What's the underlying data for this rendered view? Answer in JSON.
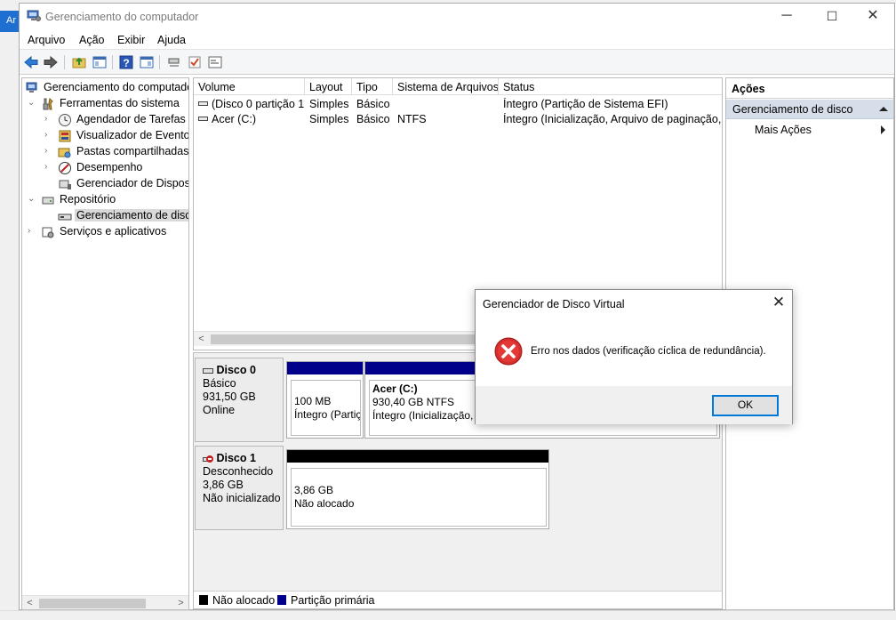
{
  "background": {
    "left_text": "Ar"
  },
  "window": {
    "title": "Gerenciamento do computador",
    "controls": {
      "minimize": "─",
      "maximize": "☐",
      "close": "✕"
    }
  },
  "menu": [
    "Arquivo",
    "Ação",
    "Exibir",
    "Ajuda"
  ],
  "toolbar": [
    "back-arrow-icon",
    "forward-arrow-icon",
    "up-folder-icon",
    "show-hide-tree-icon",
    "help-icon",
    "properties-icon",
    "connect-icon",
    "check-icon",
    "console-icon"
  ],
  "tree": {
    "root": "Gerenciamento do computado",
    "items": [
      {
        "label": "Ferramentas do sistema",
        "expander": "⌄"
      },
      {
        "label": "Agendador de Tarefas",
        "expander": "›"
      },
      {
        "label": "Visualizador de Eventos",
        "expander": "›"
      },
      {
        "label": "Pastas compartilhadas",
        "expander": "›"
      },
      {
        "label": "Desempenho",
        "expander": "›"
      },
      {
        "label": "Gerenciador de Disposit",
        "expander": ""
      },
      {
        "label": "Repositório",
        "expander": "⌄"
      },
      {
        "label": "Gerenciamento de disco",
        "expander": ""
      },
      {
        "label": "Serviços e aplicativos",
        "expander": "›"
      }
    ]
  },
  "volumes": {
    "columns": [
      "Volume",
      "Layout",
      "Tipo",
      "Sistema de Arquivos",
      "Status"
    ],
    "rows": [
      [
        "(Disco 0 partição 1)",
        "Simples",
        "Básico",
        "",
        "Íntegro (Partição de Sistema EFI)"
      ],
      [
        "Acer (C:)",
        "Simples",
        "Básico",
        "NTFS",
        "Íntegro (Inicialização, Arquivo de paginação, D"
      ]
    ]
  },
  "disks": [
    {
      "name": "Disco 0",
      "type": "Básico",
      "size": "931,50 GB",
      "state": "Online",
      "partitions": [
        {
          "title": "",
          "size": "100 MB",
          "status": "Íntegro (Partiç"
        },
        {
          "title": "Acer  (C:)",
          "size": "930,40 GB NTFS",
          "status": "Íntegro (Inicialização, A"
        }
      ]
    },
    {
      "name": "Disco 1",
      "type": "Desconhecido",
      "size": "3,86 GB",
      "state": "Não inicializado",
      "partitions": [
        {
          "size": "3,86 GB",
          "status": "Não alocado"
        }
      ]
    }
  ],
  "legend": [
    {
      "label": "Não alocado",
      "color": "#000000"
    },
    {
      "label": "Partição primária",
      "color": "#00008b"
    }
  ],
  "actions": {
    "header": "Ações",
    "section": "Gerenciamento de disco",
    "item": "Mais Ações"
  },
  "dialog": {
    "title": "Gerenciador de Disco Virtual",
    "message": "Erro nos dados (verificação cíclica de redundância).",
    "ok": "OK"
  },
  "colors": {
    "primary_partition": "#00008b",
    "unallocated": "#000000",
    "error": "#d32f2f",
    "selection": "#d6dfe9"
  }
}
